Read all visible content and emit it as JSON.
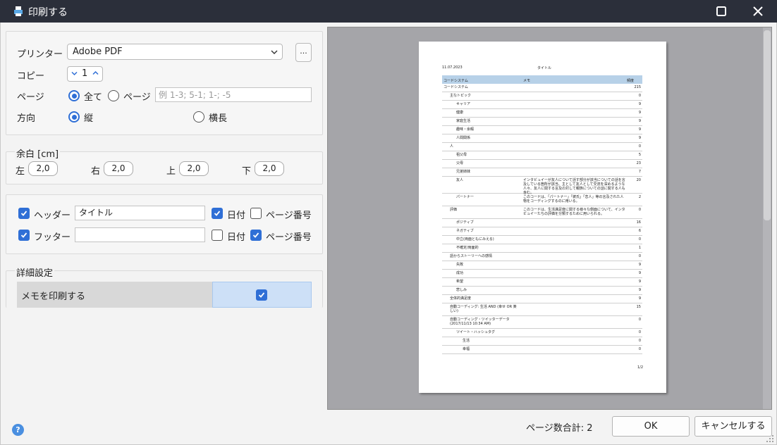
{
  "window": {
    "title": "印刷する"
  },
  "printer": {
    "label": "プリンター",
    "value": "Adobe PDF",
    "more_label": "..."
  },
  "copies": {
    "label": "コピー",
    "value": "1"
  },
  "pages": {
    "label": "ページ",
    "all_label": "全て",
    "range_label": "ページ",
    "range_placeholder": "例 1-3; 5-1; 1-; -5",
    "selected": "all"
  },
  "orientation": {
    "label": "方向",
    "portrait_label": "縦",
    "landscape_label": "横長",
    "selected": "portrait"
  },
  "margins": {
    "legend": "余白 [cm]",
    "left_label": "左",
    "left": "2,0",
    "right_label": "右",
    "right": "2,0",
    "top_label": "上",
    "top": "2,0",
    "bottom_label": "下",
    "bottom": "2,0"
  },
  "header": {
    "label": "ヘッダー",
    "checked": true,
    "text": "タイトル",
    "date_label": "日付",
    "date_checked": true,
    "page_label": "ページ番号",
    "page_checked": false
  },
  "footer": {
    "label": "フッター",
    "checked": true,
    "text": "",
    "date_label": "日付",
    "date_checked": false,
    "page_label": "ページ番号",
    "page_checked": true
  },
  "advanced": {
    "legend": "詳細設定",
    "print_memo_label": "メモを印刷する",
    "print_memo_checked": true
  },
  "preview": {
    "date": "11.07.2023",
    "title": "タイトル",
    "page_footer": "1/2",
    "columns": [
      "コードシステム",
      "メモ",
      "頻度"
    ],
    "rows": [
      {
        "indent": 0,
        "name": "コードシステム",
        "memo": "",
        "count": "215"
      },
      {
        "indent": 1,
        "name": "主なトピック",
        "memo": "",
        "count": "0"
      },
      {
        "indent": 2,
        "name": "キャリア",
        "memo": "",
        "count": "9"
      },
      {
        "indent": 2,
        "name": "健康",
        "memo": "",
        "count": "9"
      },
      {
        "indent": 2,
        "name": "家庭生活",
        "memo": "",
        "count": "9"
      },
      {
        "indent": 2,
        "name": "趣味・余暇",
        "memo": "",
        "count": "9"
      },
      {
        "indent": 2,
        "name": "人間関係",
        "memo": "",
        "count": "9"
      },
      {
        "indent": 1,
        "name": "人",
        "memo": "",
        "count": "0"
      },
      {
        "indent": 2,
        "name": "祖父母",
        "memo": "",
        "count": "5"
      },
      {
        "indent": 2,
        "name": "父母",
        "memo": "",
        "count": "23"
      },
      {
        "indent": 2,
        "name": "兄弟姉妹",
        "memo": "",
        "count": "7"
      },
      {
        "indent": 2,
        "name": "友人",
        "memo": "インタビュイーが友人について話す部分が該当についての話を言及している箇所が該当、主として友人として交流を深めるような人々、友人に関する言及の対して親族についての話に関する人も含む。",
        "count": "20"
      },
      {
        "indent": 2,
        "name": "パートナー",
        "memo": "このコードは、「パートナー」「彼氏」「恋人」等の言及された人物をコーディングするのに用いる。",
        "count": "2"
      },
      {
        "indent": 1,
        "name": "評価",
        "memo": "このコードは、生活満足度に関する様々な側面について、インタビュイーたちの評価を分類するために用いられる。",
        "count": "0"
      },
      {
        "indent": 2,
        "name": "ポジティブ",
        "memo": "",
        "count": "16"
      },
      {
        "indent": 2,
        "name": "ネガティブ",
        "memo": "",
        "count": "6"
      },
      {
        "indent": 2,
        "name": "中立(両面ともにみえる)",
        "memo": "",
        "count": "0"
      },
      {
        "indent": 2,
        "name": "不確定/両面的",
        "memo": "",
        "count": "1"
      },
      {
        "indent": 1,
        "name": "語からストーリーへの感情",
        "memo": "",
        "count": "0"
      },
      {
        "indent": 2,
        "name": "失敗",
        "memo": "",
        "count": "9"
      },
      {
        "indent": 2,
        "name": "成功",
        "memo": "",
        "count": "9"
      },
      {
        "indent": 2,
        "name": "希望",
        "memo": "",
        "count": "9"
      },
      {
        "indent": 2,
        "name": "悲しみ",
        "memo": "",
        "count": "9"
      },
      {
        "indent": 1,
        "name": "全体的満足度",
        "memo": "",
        "count": "9"
      },
      {
        "indent": 1,
        "name": "自動コーディング: 生活 AND (幸せ OR 楽しい)",
        "memo": "",
        "count": "15"
      },
      {
        "indent": 1,
        "name": "自動コーディング・ツイッターデータ (2017/11/13 10:34 AM)",
        "memo": "",
        "count": "0"
      },
      {
        "indent": 2,
        "name": "ツイート・ハッシュタグ",
        "memo": "",
        "count": "0"
      },
      {
        "indent": 3,
        "name": "生活",
        "memo": "",
        "count": "0"
      },
      {
        "indent": 3,
        "name": "幸福",
        "memo": "",
        "count": "0"
      }
    ]
  },
  "footer_bar": {
    "page_total": "ページ数合計: 2",
    "ok_label": "OK",
    "cancel_label": "キャンセルする",
    "help_label": "?"
  }
}
